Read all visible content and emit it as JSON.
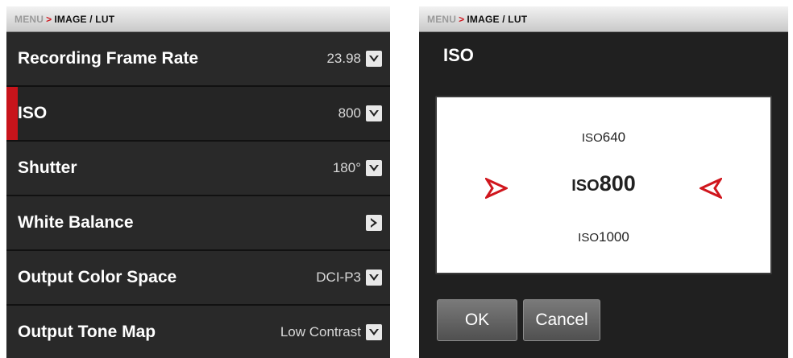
{
  "left": {
    "breadcrumb": {
      "menu": "MENU",
      "separator": ">",
      "current": "IMAGE / LUT"
    },
    "items": [
      {
        "label": "Recording Frame Rate",
        "value": "23.98",
        "control": "chevron-down-icon"
      },
      {
        "label": "ISO",
        "value": "800",
        "control": "chevron-down-icon",
        "selected": true
      },
      {
        "label": "Shutter",
        "value": "180°",
        "control": "chevron-down-icon"
      },
      {
        "label": "White Balance",
        "value": "",
        "control": "chevron-right-icon"
      },
      {
        "label": "Output Color Space",
        "value": "DCI-P3",
        "control": "chevron-down-icon"
      },
      {
        "label": "Output Tone Map",
        "value": "Low Contrast",
        "control": "chevron-down-icon"
      }
    ]
  },
  "right": {
    "breadcrumb": {
      "menu": "MENU",
      "separator": ">",
      "current": "IMAGE / LUT"
    },
    "title": "ISO",
    "picker": {
      "previous": {
        "prefix": "ISO",
        "value": "640"
      },
      "current": {
        "prefix": "ISO",
        "value": "800"
      },
      "next": {
        "prefix": "ISO",
        "value": "1000"
      }
    },
    "buttons": {
      "ok": "OK",
      "cancel": "Cancel"
    }
  },
  "colors": {
    "accent_red": "#c8141b",
    "panel_bg": "#202020",
    "row_bg": "#292929",
    "picker_bg": "#ffffff"
  }
}
